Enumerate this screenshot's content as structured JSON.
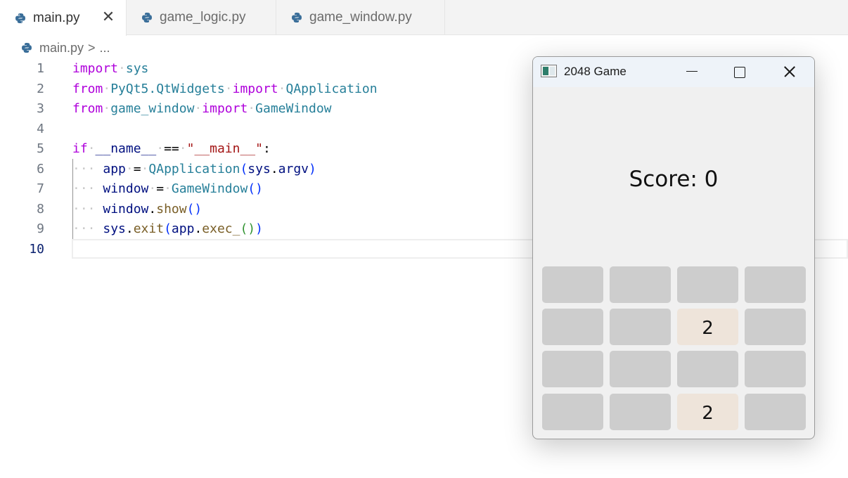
{
  "tabs": [
    {
      "label": "main.py",
      "active": true
    },
    {
      "label": "game_logic.py",
      "active": false
    },
    {
      "label": "game_window.py",
      "active": false
    }
  ],
  "tab_close_glyph": "✕",
  "breadcrumb": {
    "file": "main.py",
    "separator": ">",
    "ellipsis": "..."
  },
  "editor": {
    "line_numbers": [
      "1",
      "2",
      "3",
      "4",
      "5",
      "6",
      "7",
      "8",
      "9",
      "10"
    ],
    "current_line": "10"
  },
  "game_window": {
    "title": "2048 Game",
    "score_text": "Score: 0",
    "grid": [
      [
        "",
        "",
        "",
        ""
      ],
      [
        "",
        "",
        "2",
        ""
      ],
      [
        "",
        "",
        "",
        ""
      ],
      [
        "",
        "",
        "2",
        ""
      ]
    ]
  },
  "colors": {
    "keyword": "#af00db",
    "module": "#267f99",
    "variable": "#001080",
    "function": "#795e26",
    "string": "#a31515",
    "tile_empty": "#cdcdcd",
    "tile_2": "#eee4da"
  },
  "icons": {
    "tab": "python-icon",
    "close": "close-icon",
    "window_min": "minimize-icon",
    "window_max": "maximize-icon",
    "window_close": "close-icon"
  }
}
